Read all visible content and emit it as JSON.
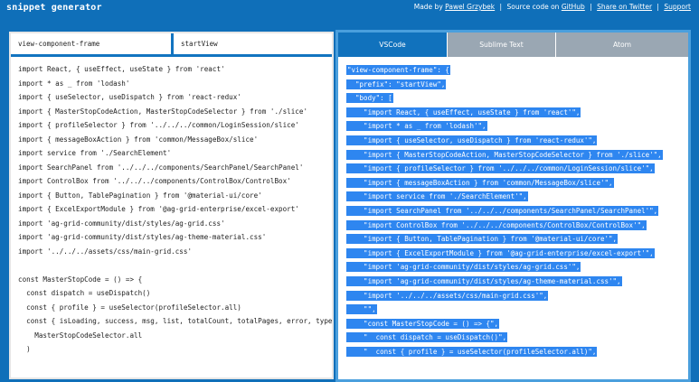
{
  "header": {
    "title": "snippet generator",
    "made_by_prefix": "Made by",
    "author": "Pawel Grzybek",
    "source_prefix": "Source code on",
    "github": "GitHub",
    "twitter": "Share on Twitter",
    "support": "Support",
    "separator": "|"
  },
  "inputs": {
    "snippet_name": "view-component-frame",
    "tab_trigger": "startView"
  },
  "code_lines": [
    "import React, { useEffect, useState } from 'react'",
    "import * as _ from 'lodash'",
    "import { useSelector, useDispatch } from 'react-redux'",
    "import { MasterStopCodeAction, MasterStopCodeSelector } from './slice'",
    "import { profileSelector } from '../../../common/LoginSession/slice'",
    "import { messageBoxAction } from 'common/MessageBox/slice'",
    "import service from './SearchElement'",
    "import SearchPanel from '../../../components/SearchPanel/SearchPanel'",
    "import ControlBox from '../../../components/ControlBox/ControlBox'",
    "import { Button, TablePagination } from '@material-ui/core'",
    "import { ExcelExportModule } from '@ag-grid-enterprise/excel-export'",
    "import 'ag-grid-community/dist/styles/ag-grid.css'",
    "import 'ag-grid-community/dist/styles/ag-theme-material.css'",
    "import '../../../assets/css/main-grid.css'",
    "",
    "const MasterStopCode = () => {",
    "  const dispatch = useDispatch()",
    "  const { profile } = useSelector(profileSelector.all)",
    "  const { isLoading, success, msg, list, totalCount, totalPages, error, type }",
    "    MasterStopCodeSelector.all",
    "  )"
  ],
  "tabs": {
    "vscode": "VSCode",
    "sublime": "Sublime Text",
    "atom": "Atom"
  },
  "output_lines": [
    "\"view-component-frame\": {",
    "  \"prefix\": \"startView\",",
    "  \"body\": [",
    "    \"import React, { useEffect, useState } from 'react'\",",
    "    \"import * as _ from 'lodash'\",",
    "    \"import { useSelector, useDispatch } from 'react-redux'\",",
    "    \"import { MasterStopCodeAction, MasterStopCodeSelector } from './slice'\",",
    "    \"import { profileSelector } from '../../../common/LoginSession/slice'\",",
    "    \"import { messageBoxAction } from 'common/MessageBox/slice'\",",
    "    \"import service from './SearchElement'\",",
    "    \"import SearchPanel from '../../../components/SearchPanel/SearchPanel'\",",
    "    \"import ControlBox from '../../../components/ControlBox/ControlBox'\",",
    "    \"import { Button, TablePagination } from '@material-ui/core'\",",
    "    \"import { ExcelExportModule } from '@ag-grid-enterprise/excel-export'\",",
    "    \"import 'ag-grid-community/dist/styles/ag-grid.css'\",",
    "    \"import 'ag-grid-community/dist/styles/ag-theme-material.css'\",",
    "    \"import '../../../assets/css/main-grid.css'\",",
    "    \"\",",
    "    \"const MasterStopCode = () => {\",",
    "    \"  const dispatch = useDispatch()\",",
    "    \"  const { profile } = useSelector(profileSelector.all)\","
  ],
  "colors": {
    "background": "#0f6fb9",
    "active_tab": "#1172bd",
    "inactive_tab": "#9aa7b3",
    "selection": "#2e86f0"
  }
}
